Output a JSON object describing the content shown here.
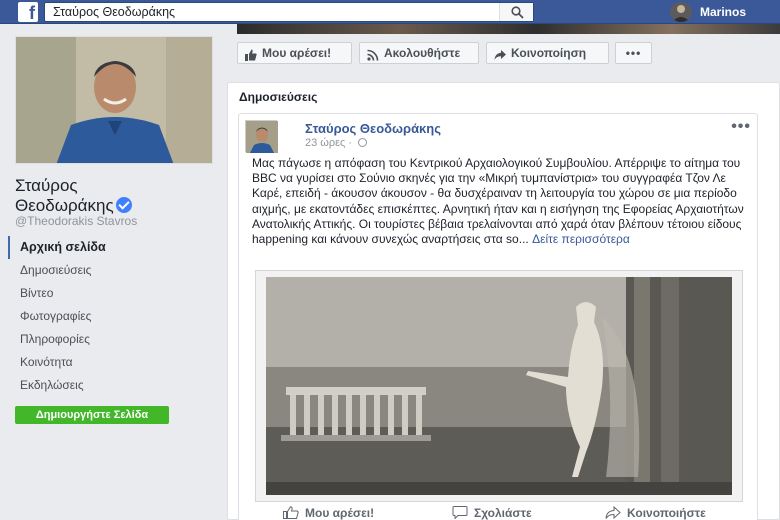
{
  "topbar": {
    "logo": "f",
    "search_value": "Σταύρος Θεοδωράκης",
    "user_name": "Marinos"
  },
  "page": {
    "name_line1": "Σταύρος",
    "name_line2": "Θεοδωράκης",
    "handle": "@Theodorakis Stavros"
  },
  "nav": {
    "items": [
      {
        "label": "Αρχική σελίδα",
        "active": true
      },
      {
        "label": "Δημοσιεύσεις"
      },
      {
        "label": "Βίντεο"
      },
      {
        "label": "Φωτογραφίες"
      },
      {
        "label": "Πληροφορίες"
      },
      {
        "label": "Κοινότητα"
      },
      {
        "label": "Εκδηλώσεις"
      }
    ]
  },
  "create_page_label": "Δημιουργήστε Σελίδα",
  "actions": {
    "like": "Μου αρέσει!",
    "follow": "Ακολουθήστε",
    "share": "Κοινοποίηση",
    "more": "•••"
  },
  "posts": {
    "section_title": "Δημοσιεύσεις",
    "author": "Σταύρος Θεοδωράκης",
    "time": "23 ώρες · ",
    "menu": "•••",
    "text": "Μας πάγωσε η απόφαση του Κεντρικού Αρχαιολογικού Συμβουλίου. Απέρριψε το αίτημα του BBC να γυρίσει στο Σούνιο σκηνές για την «Μικρή τυμπανίστρια» του συγγραφέα Τζον Λε Καρέ, επειδή - άκουσον άκουσον - θα δυσχέραιναν τη λειτουργία του χώρου σε μια περίοδο αιχμής, με εκατοντάδες επισκέπτες. Αρνητική ήταν και η εισήγηση της Εφορείας Αρχαιοτήτων Ανατολικής Αττικής. Οι τουρίστες βέβαια τρελαίνονται από χαρά όταν βλέπουν τέτοιου είδους happening και κάνουν συνεχώς αναρτήσεις στα so... ",
    "see_more": "Δείτε περισσότερα"
  },
  "reactions": {
    "like": "Μου αρέσει!",
    "comment": "Σχολιάστε",
    "share": "Κοινοποιήστε"
  },
  "colors": {
    "facebook_blue": "#3b5998",
    "link_blue": "#385898",
    "green": "#42b72a",
    "verified": "#4080ff"
  }
}
